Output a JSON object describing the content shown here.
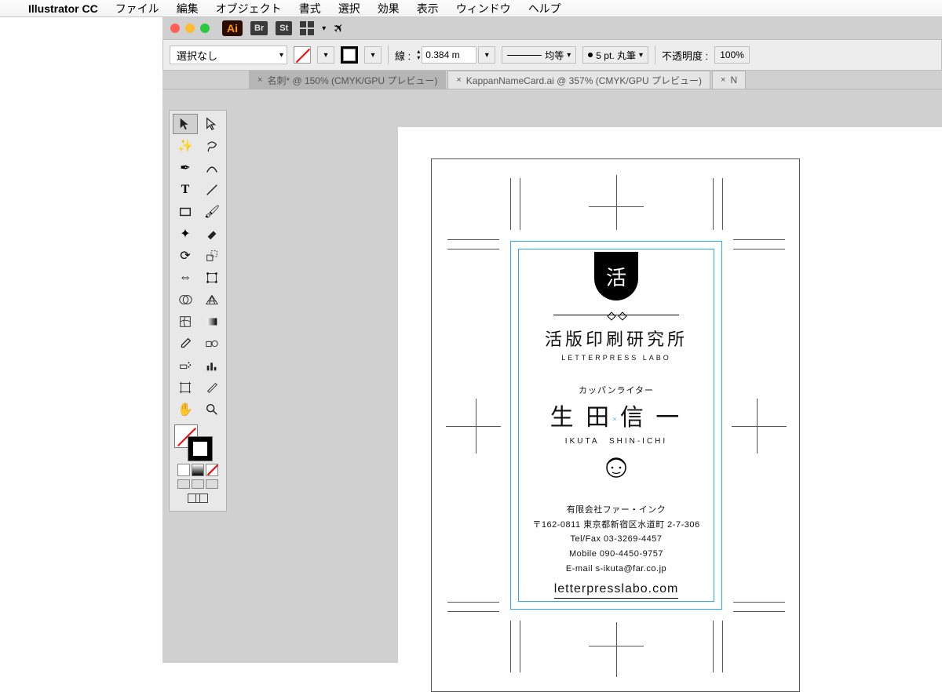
{
  "menubar": {
    "app": "Illustrator CC",
    "items": [
      "ファイル",
      "編集",
      "オブジェクト",
      "書式",
      "選択",
      "効果",
      "表示",
      "ウィンドウ",
      "ヘルプ"
    ]
  },
  "title_row": {
    "bridge_chip": "Br",
    "stock_chip": "St"
  },
  "control": {
    "selection_label": "選択なし",
    "stroke_label": "線 :",
    "stroke_weight": "0.384 m",
    "dash_label": "均等",
    "brush_label": "5 pt. 丸筆",
    "opacity_label": "不透明度 :",
    "opacity_value": "100%"
  },
  "tabs": [
    "名刺* @ 150% (CMYK/GPU プレビュー)",
    "KappanNameCard.ai @ 357% (CMYK/GPU プレビュー)",
    "N"
  ],
  "card": {
    "badge_char": "活",
    "company_ja": "活版印刷研究所",
    "company_en": "LETTERPRESS LABO",
    "role": "カッパンライター",
    "name_last": "生 田",
    "name_first": "信 一",
    "name_en": "IKUTA　SHIN-ICHI",
    "contact_company": "有限会社ファー・インク",
    "contact_addr": "〒162-0811 東京都新宿区水道町 2-7-306",
    "contact_tel": "Tel/Fax 03-3269-4457",
    "contact_mobile": "Mobile 090-4450-9757",
    "contact_email": "E-mail s-ikuta@far.co.jp",
    "url": "letterpresslabo.com"
  }
}
